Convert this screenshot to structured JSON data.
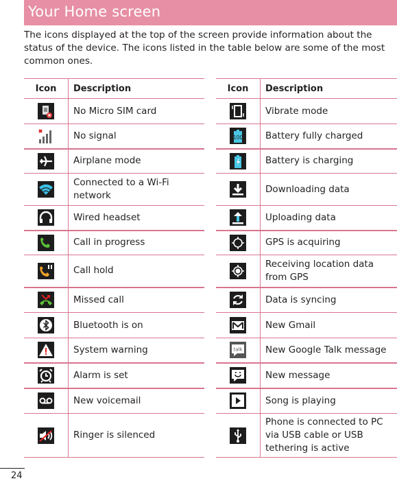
{
  "header": {
    "title": "Your Home screen"
  },
  "intro": "The icons displayed at the top of the screen provide information about the status of the device. The icons listed in the table below are some of the most common ones.",
  "table_headers": {
    "icon": "Icon",
    "description": "Description"
  },
  "left_table": [
    {
      "icon": "no-sim-card-icon",
      "description": "No Micro SIM card"
    },
    {
      "icon": "no-signal-icon",
      "description": "No signal"
    },
    {
      "icon": "airplane-icon",
      "description": "Airplane mode"
    },
    {
      "icon": "wifi-icon",
      "description": "Connected to a Wi-Fi network"
    },
    {
      "icon": "headset-icon",
      "description": "Wired headset"
    },
    {
      "icon": "call-in-progress-icon",
      "description": "Call in progress"
    },
    {
      "icon": "call-hold-icon",
      "description": "Call hold"
    },
    {
      "icon": "missed-call-icon",
      "description": "Missed call"
    },
    {
      "icon": "bluetooth-icon",
      "description": "Bluetooth is on"
    },
    {
      "icon": "warning-icon",
      "description": "System warning"
    },
    {
      "icon": "alarm-icon",
      "description": "Alarm is set"
    },
    {
      "icon": "voicemail-icon",
      "description": "New voicemail"
    },
    {
      "icon": "ringer-silenced-icon",
      "description": "Ringer is silenced"
    }
  ],
  "right_table": [
    {
      "icon": "vibrate-icon",
      "description": "Vibrate mode"
    },
    {
      "icon": "battery-full-icon",
      "description": "Battery fully charged",
      "badge": "100"
    },
    {
      "icon": "battery-charging-icon",
      "description": "Battery is charging"
    },
    {
      "icon": "download-icon",
      "description": "Downloading data"
    },
    {
      "icon": "upload-icon",
      "description": "Uploading data"
    },
    {
      "icon": "gps-acquiring-icon",
      "description": "GPS is acquiring"
    },
    {
      "icon": "gps-receiving-icon",
      "description": "Receiving location data from GPS"
    },
    {
      "icon": "sync-icon",
      "description": "Data is syncing"
    },
    {
      "icon": "gmail-icon",
      "description": "New Gmail"
    },
    {
      "icon": "google-talk-icon",
      "description": "New Google Talk message",
      "badge": "talk"
    },
    {
      "icon": "message-icon",
      "description": "New message"
    },
    {
      "icon": "play-icon",
      "description": "Song is playing"
    },
    {
      "icon": "usb-icon",
      "description": "Phone is connected to PC via USB cable or USB tethering is active"
    }
  ],
  "page_number": "24",
  "colors": {
    "header_bg": "#e78fa4",
    "rule": "#d8758f",
    "icon_bg": "#1d1d1d"
  }
}
